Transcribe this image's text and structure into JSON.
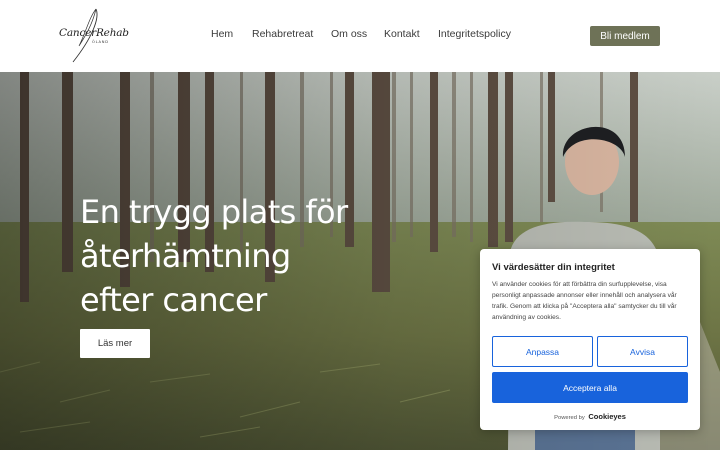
{
  "header": {
    "logo": {
      "name": "CancerRehab",
      "sub": "ÖLAND"
    },
    "nav": [
      {
        "label": "Hem"
      },
      {
        "label": "Rehabretreat"
      },
      {
        "label": "Om oss"
      },
      {
        "label": "Kontakt"
      },
      {
        "label": "Integritetspolicy"
      }
    ],
    "join_label": "Bli medlem"
  },
  "hero": {
    "title_lines": [
      "En trygg plats för",
      "återhämtning",
      "efter cancer"
    ],
    "read_more_label": "Läs mer"
  },
  "cookie": {
    "title": "Vi värdesätter din integritet",
    "body": "Vi använder cookies för att förbättra din surfupplevelse, visa personligt anpassade annonser eller innehåll och analysera vår trafik. Genom att klicka på \"Acceptera alla\" samtycker du till vår användning av cookies.",
    "customize_label": "Anpassa",
    "reject_label": "Avvisa",
    "accept_label": "Acceptera alla",
    "powered_by": "Powered by",
    "powered_brand": "Cookieyes"
  },
  "colors": {
    "join_button": "#6e7257",
    "cookie_primary": "#1863dc"
  }
}
